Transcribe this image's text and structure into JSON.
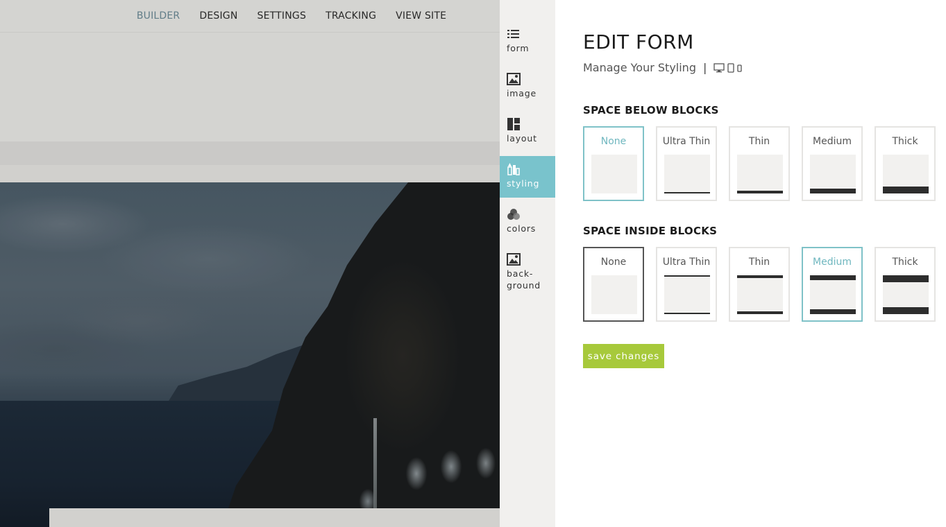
{
  "top_nav": {
    "items": [
      "BUILDER",
      "DESIGN",
      "SETTINGS",
      "TRACKING",
      "VIEW SITE"
    ],
    "active": "BUILDER"
  },
  "rail": {
    "items": [
      {
        "label": "form",
        "icon": "list-icon"
      },
      {
        "label": "image",
        "icon": "image-icon"
      },
      {
        "label": "layout",
        "icon": "layout-icon"
      },
      {
        "label": "styling",
        "icon": "styling-icon",
        "active": true
      },
      {
        "label": "colors",
        "icon": "colors-icon"
      },
      {
        "label": "back-\nground",
        "icon": "background-image-icon"
      }
    ]
  },
  "panel": {
    "title": "EDIT FORM",
    "subtitle": "Manage Your Styling",
    "separator": "|",
    "device_icons": [
      "desktop-icon",
      "tablet-icon",
      "mobile-icon"
    ]
  },
  "space_below": {
    "heading": "SPACE BELOW BLOCKS",
    "options": [
      "None",
      "Ultra Thin",
      "Thin",
      "Medium",
      "Thick"
    ],
    "selected": "None"
  },
  "space_inside": {
    "heading": "SPACE INSIDE BLOCKS",
    "options": [
      "None",
      "Ultra Thin",
      "Thin",
      "Medium",
      "Thick"
    ],
    "selected": "Medium"
  },
  "save_button": "save changes",
  "colors": {
    "accent": "#79c3cc",
    "save": "#a7c93b",
    "selected_border": "#7fc2c8"
  }
}
